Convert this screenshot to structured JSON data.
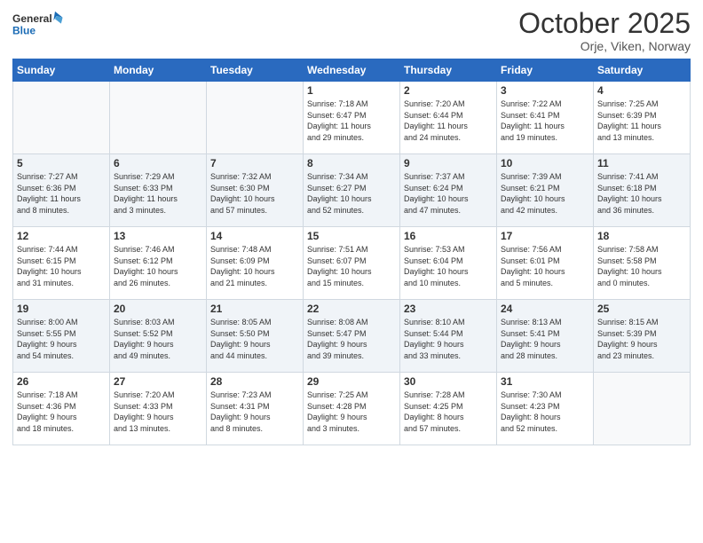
{
  "logo": {
    "line1": "General",
    "line2": "Blue"
  },
  "title": "October 2025",
  "location": "Orje, Viken, Norway",
  "weekdays": [
    "Sunday",
    "Monday",
    "Tuesday",
    "Wednesday",
    "Thursday",
    "Friday",
    "Saturday"
  ],
  "weeks": [
    [
      {
        "day": "",
        "info": ""
      },
      {
        "day": "",
        "info": ""
      },
      {
        "day": "",
        "info": ""
      },
      {
        "day": "1",
        "info": "Sunrise: 7:18 AM\nSunset: 6:47 PM\nDaylight: 11 hours\nand 29 minutes."
      },
      {
        "day": "2",
        "info": "Sunrise: 7:20 AM\nSunset: 6:44 PM\nDaylight: 11 hours\nand 24 minutes."
      },
      {
        "day": "3",
        "info": "Sunrise: 7:22 AM\nSunset: 6:41 PM\nDaylight: 11 hours\nand 19 minutes."
      },
      {
        "day": "4",
        "info": "Sunrise: 7:25 AM\nSunset: 6:39 PM\nDaylight: 11 hours\nand 13 minutes."
      }
    ],
    [
      {
        "day": "5",
        "info": "Sunrise: 7:27 AM\nSunset: 6:36 PM\nDaylight: 11 hours\nand 8 minutes."
      },
      {
        "day": "6",
        "info": "Sunrise: 7:29 AM\nSunset: 6:33 PM\nDaylight: 11 hours\nand 3 minutes."
      },
      {
        "day": "7",
        "info": "Sunrise: 7:32 AM\nSunset: 6:30 PM\nDaylight: 10 hours\nand 57 minutes."
      },
      {
        "day": "8",
        "info": "Sunrise: 7:34 AM\nSunset: 6:27 PM\nDaylight: 10 hours\nand 52 minutes."
      },
      {
        "day": "9",
        "info": "Sunrise: 7:37 AM\nSunset: 6:24 PM\nDaylight: 10 hours\nand 47 minutes."
      },
      {
        "day": "10",
        "info": "Sunrise: 7:39 AM\nSunset: 6:21 PM\nDaylight: 10 hours\nand 42 minutes."
      },
      {
        "day": "11",
        "info": "Sunrise: 7:41 AM\nSunset: 6:18 PM\nDaylight: 10 hours\nand 36 minutes."
      }
    ],
    [
      {
        "day": "12",
        "info": "Sunrise: 7:44 AM\nSunset: 6:15 PM\nDaylight: 10 hours\nand 31 minutes."
      },
      {
        "day": "13",
        "info": "Sunrise: 7:46 AM\nSunset: 6:12 PM\nDaylight: 10 hours\nand 26 minutes."
      },
      {
        "day": "14",
        "info": "Sunrise: 7:48 AM\nSunset: 6:09 PM\nDaylight: 10 hours\nand 21 minutes."
      },
      {
        "day": "15",
        "info": "Sunrise: 7:51 AM\nSunset: 6:07 PM\nDaylight: 10 hours\nand 15 minutes."
      },
      {
        "day": "16",
        "info": "Sunrise: 7:53 AM\nSunset: 6:04 PM\nDaylight: 10 hours\nand 10 minutes."
      },
      {
        "day": "17",
        "info": "Sunrise: 7:56 AM\nSunset: 6:01 PM\nDaylight: 10 hours\nand 5 minutes."
      },
      {
        "day": "18",
        "info": "Sunrise: 7:58 AM\nSunset: 5:58 PM\nDaylight: 10 hours\nand 0 minutes."
      }
    ],
    [
      {
        "day": "19",
        "info": "Sunrise: 8:00 AM\nSunset: 5:55 PM\nDaylight: 9 hours\nand 54 minutes."
      },
      {
        "day": "20",
        "info": "Sunrise: 8:03 AM\nSunset: 5:52 PM\nDaylight: 9 hours\nand 49 minutes."
      },
      {
        "day": "21",
        "info": "Sunrise: 8:05 AM\nSunset: 5:50 PM\nDaylight: 9 hours\nand 44 minutes."
      },
      {
        "day": "22",
        "info": "Sunrise: 8:08 AM\nSunset: 5:47 PM\nDaylight: 9 hours\nand 39 minutes."
      },
      {
        "day": "23",
        "info": "Sunrise: 8:10 AM\nSunset: 5:44 PM\nDaylight: 9 hours\nand 33 minutes."
      },
      {
        "day": "24",
        "info": "Sunrise: 8:13 AM\nSunset: 5:41 PM\nDaylight: 9 hours\nand 28 minutes."
      },
      {
        "day": "25",
        "info": "Sunrise: 8:15 AM\nSunset: 5:39 PM\nDaylight: 9 hours\nand 23 minutes."
      }
    ],
    [
      {
        "day": "26",
        "info": "Sunrise: 7:18 AM\nSunset: 4:36 PM\nDaylight: 9 hours\nand 18 minutes."
      },
      {
        "day": "27",
        "info": "Sunrise: 7:20 AM\nSunset: 4:33 PM\nDaylight: 9 hours\nand 13 minutes."
      },
      {
        "day": "28",
        "info": "Sunrise: 7:23 AM\nSunset: 4:31 PM\nDaylight: 9 hours\nand 8 minutes."
      },
      {
        "day": "29",
        "info": "Sunrise: 7:25 AM\nSunset: 4:28 PM\nDaylight: 9 hours\nand 3 minutes."
      },
      {
        "day": "30",
        "info": "Sunrise: 7:28 AM\nSunset: 4:25 PM\nDaylight: 8 hours\nand 57 minutes."
      },
      {
        "day": "31",
        "info": "Sunrise: 7:30 AM\nSunset: 4:23 PM\nDaylight: 8 hours\nand 52 minutes."
      },
      {
        "day": "",
        "info": ""
      }
    ]
  ]
}
